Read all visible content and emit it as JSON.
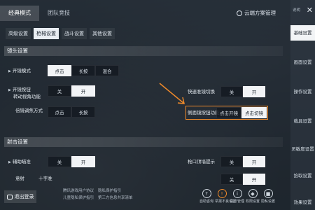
{
  "mode_tabs": [
    {
      "label": "经典模式",
      "active": true
    },
    {
      "label": "团队竞技",
      "active": false
    }
  ],
  "cloud_button": {
    "label": "云端方案管理",
    "icon": "cloud-icon"
  },
  "sub_tabs": [
    {
      "label": "高级设置",
      "active": false
    },
    {
      "label": "枪械设置",
      "active": true
    },
    {
      "label": "战斗设置",
      "active": false
    },
    {
      "label": "其他设置",
      "active": false
    }
  ],
  "sections": {
    "scope": "镜头设置",
    "shoot": "射击设置"
  },
  "rows": {
    "scope_mode": {
      "label": "开镜模式",
      "options": [
        "点击",
        "长按",
        "混合"
      ],
      "selected": 0
    },
    "scope_btn_turn": {
      "label1": "开镜按钮",
      "label2": "转动视角功能",
      "options": [
        "关",
        "开"
      ],
      "selected": 1
    },
    "sniper_switch": {
      "label": "倍镜调焦方式",
      "options": [
        "点击",
        "长按"
      ],
      "selected": 0
    },
    "quick_switch": {
      "label": "快速准镜切换",
      "options": [
        "关",
        "开"
      ],
      "selected": 1
    },
    "side_scope": {
      "label": "侧面镜按钮功能",
      "options": [
        "点击开镜",
        "点击切镜"
      ],
      "selected": 1
    },
    "aim_assist": {
      "label": "辅助瞄准",
      "options": [
        "关",
        "开"
      ],
      "selected": 1
    },
    "crosshair": {
      "label": "十字准",
      "prefix": "意射",
      "options": []
    },
    "bullet_hint": {
      "label": "枪口顶墙提示",
      "options": [
        "关",
        "开"
      ],
      "selected": 1
    },
    "bullet_hint2": {
      "label": "",
      "options": [
        "关",
        "开"
      ],
      "selected": 1
    }
  },
  "bottom": {
    "logout_label": "退出登录",
    "links_row1": [
      "腾讯游戏用户协议",
      "隐私保护指引"
    ],
    "links_row2": [
      "儿童隐私保护指引",
      "第三方信息共享清单"
    ],
    "utilities": [
      {
        "label": "自助咨询",
        "icon": "headset-icon",
        "glyph": "?"
      },
      {
        "label": "举报不良语音",
        "icon": "warning-icon",
        "glyph": "!"
      },
      {
        "label": "信息管理",
        "icon": "info-icon",
        "glyph": "i"
      },
      {
        "label": "权限设置",
        "icon": "shield-icon",
        "glyph": "◆"
      },
      {
        "label": "隐私设置",
        "icon": "lock-icon",
        "glyph": "■"
      }
    ]
  },
  "sidebar": {
    "tag": "说明",
    "items": [
      {
        "label": "基础设置",
        "active": true
      },
      {
        "label": "画面设置",
        "active": false
      },
      {
        "label": "操作设置",
        "active": false
      },
      {
        "label": "载具设置",
        "active": false
      },
      {
        "label": "灵敏度设置",
        "active": false
      },
      {
        "label": "拾取设置",
        "active": false
      },
      {
        "label": "效果设置",
        "active": false
      }
    ]
  },
  "colors": {
    "accent": "#f08a2a",
    "selected_bg": "#f2f4f6"
  }
}
